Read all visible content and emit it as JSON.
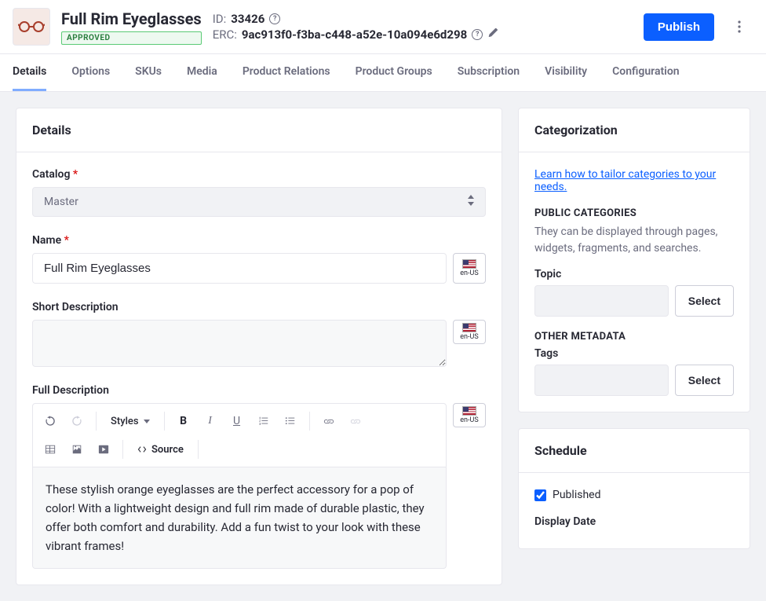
{
  "header": {
    "title": "Full Rim Eyeglasses",
    "status_badge": "APPROVED",
    "id_label": "ID:",
    "id_value": "33426",
    "erc_label": "ERC:",
    "erc_value": "9ac913f0-f3ba-c448-a52e-10a094e6d298",
    "publish_btn": "Publish"
  },
  "tabs": [
    "Details",
    "Options",
    "SKUs",
    "Media",
    "Product Relations",
    "Product Groups",
    "Subscription",
    "Visibility",
    "Configuration"
  ],
  "details": {
    "panel_title": "Details",
    "catalog_label": "Catalog",
    "catalog_value": "Master",
    "name_label": "Name",
    "name_value": "Full Rim Eyeglasses",
    "short_desc_label": "Short Description",
    "short_desc_value": "",
    "full_desc_label": "Full Description",
    "full_desc_value": "These stylish orange eyeglasses are the perfect accessory for a pop of color! With a lightweight design and full rim made of durable plastic, they offer both comfort and durability. Add a fun twist to your look with these vibrant frames!",
    "locale": "en-US",
    "toolbar": {
      "styles": "Styles",
      "source": "Source"
    }
  },
  "categorization": {
    "panel_title": "Categorization",
    "link_text": "Learn how to tailor categories to your needs.",
    "public_heading": "PUBLIC CATEGORIES",
    "public_help": "They can be displayed through pages, widgets, fragments, and searches.",
    "topic_label": "Topic",
    "other_heading": "OTHER METADATA",
    "tags_label": "Tags",
    "select_btn": "Select"
  },
  "schedule": {
    "panel_title": "Schedule",
    "published_label": "Published",
    "display_date_label": "Display Date"
  }
}
